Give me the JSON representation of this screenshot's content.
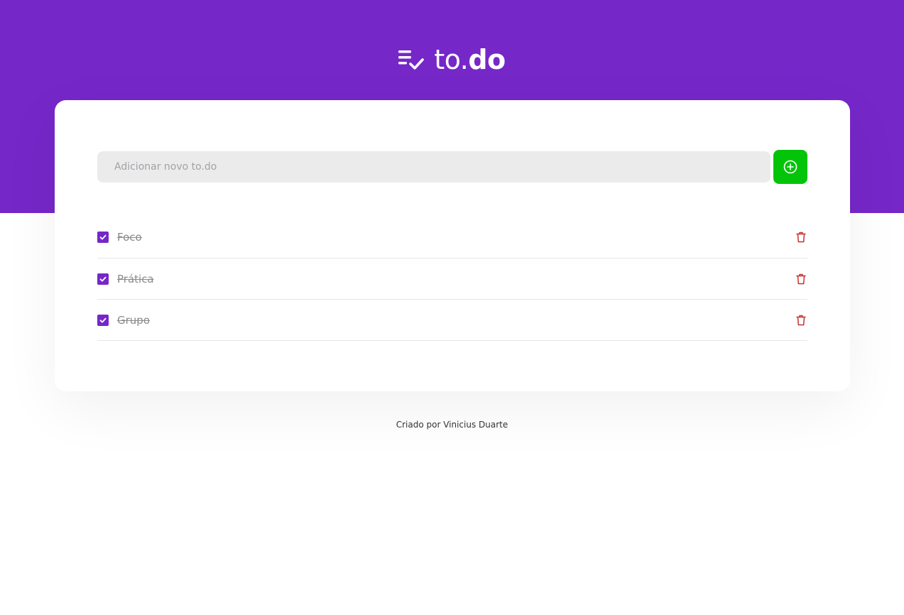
{
  "header": {
    "logo_light": "to.",
    "logo_bold": "do",
    "background_color": "#7627c8"
  },
  "new_todo": {
    "placeholder": "Adicionar novo to.do",
    "value": "",
    "add_icon": "plus-circle-icon",
    "button_color": "#04c40a"
  },
  "tasks": [
    {
      "title": "Foco",
      "done": true
    },
    {
      "title": "Prática",
      "done": true
    },
    {
      "title": "Grupo",
      "done": true
    }
  ],
  "icons": {
    "checkbox": "check-icon",
    "delete": "trash-icon",
    "delete_color": "#c53030"
  },
  "footer": {
    "text": "Criado por Vinicius Duarte"
  }
}
